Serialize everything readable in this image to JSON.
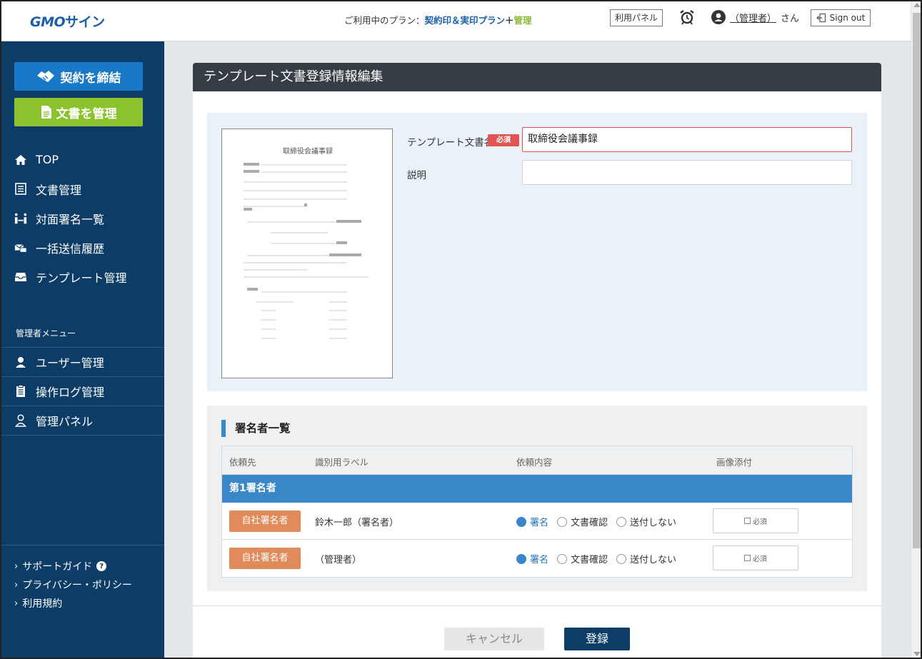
{
  "header": {
    "logo_gmo": "GMO",
    "logo_rest": "サイン",
    "plan_prefix": "ご利用中のプラン：",
    "plan_name": "契約印＆実印プラン",
    "plan_plus": "＋",
    "plan_addon": "管理",
    "panel_button": "利用パネル",
    "user_name": "（管理者）",
    "user_suffix": "さん",
    "signout_label": "Sign out"
  },
  "sidebar": {
    "contract_button": "契約を締結",
    "docs_button": "文書を管理",
    "nav": [
      {
        "label": "TOP",
        "icon": "home-icon"
      },
      {
        "label": "文書管理",
        "icon": "document-list-icon"
      },
      {
        "label": "対面署名一覧",
        "icon": "face-to-face-icon"
      },
      {
        "label": "一括送信履歴",
        "icon": "bulk-send-icon"
      },
      {
        "label": "テンプレート管理",
        "icon": "inbox-icon"
      }
    ],
    "admin_title": "管理者メニュー",
    "admin_nav": [
      {
        "label": "ユーザー管理",
        "icon": "user-icon"
      },
      {
        "label": "操作ログ管理",
        "icon": "log-icon"
      },
      {
        "label": "管理パネル",
        "icon": "admin-user-icon"
      }
    ],
    "footer": [
      {
        "label": "サポートガイド"
      },
      {
        "label": "プライバシー・ポリシー"
      },
      {
        "label": "利用規約"
      }
    ]
  },
  "main": {
    "title": "テンプレート文書登録情報編集",
    "preview_title": "取締役会議事録",
    "name_label": "テンプレート文書名",
    "required_badge": "必須",
    "name_value": "取締役会議事録",
    "desc_label": "説明",
    "desc_value": "",
    "signers": {
      "title": "署名者一覧",
      "columns": [
        "依頼先",
        "識別用ラベル",
        "依頼内容",
        "画像添付"
      ],
      "group_label": "第1署名者",
      "rows": [
        {
          "role": "自社署名者",
          "label": "鈴木一郎（署名者）",
          "options": [
            "署名",
            "文書確認",
            "送付しない"
          ],
          "selected": "署名",
          "attach": "必須"
        },
        {
          "role": "自社署名者",
          "label": "（管理者）",
          "options": [
            "署名",
            "文書確認",
            "送付しない"
          ],
          "selected": "署名",
          "attach": "必須"
        }
      ]
    },
    "cancel_button": "キャンセル",
    "submit_button": "登録"
  },
  "colors": {
    "sidebar_bg": "#0d3d66",
    "contract_btn": "#1a78c8",
    "docs_btn": "#8cc22d",
    "accent_blue": "#3a87c8",
    "role_orange": "#e08b59",
    "required_red": "#e05454"
  }
}
